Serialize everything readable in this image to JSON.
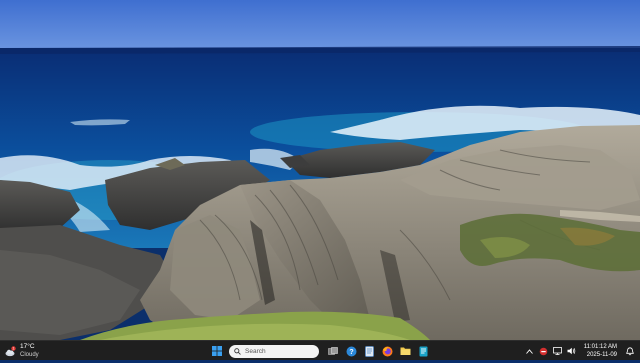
{
  "wallpaper": {
    "description_icon": "coastal-landscape",
    "colors": {
      "sky": "#3a6fd0",
      "ocean": "#0b3f86",
      "rock": "#8a8478"
    }
  },
  "taskbar": {
    "weather": {
      "temp": "17°C",
      "condition": "Cloudy",
      "badge": "1",
      "icon": "weather-cloud-icon"
    },
    "search": {
      "placeholder": "Search"
    },
    "apps": [
      {
        "name": "start",
        "icon": "windows-logo-icon"
      },
      {
        "name": "task-view",
        "icon": "task-view-icon"
      },
      {
        "name": "help",
        "icon": "help-icon"
      },
      {
        "name": "notepad",
        "icon": "notepad-icon"
      },
      {
        "name": "firefox",
        "icon": "firefox-icon"
      },
      {
        "name": "file-explorer",
        "icon": "folder-icon"
      },
      {
        "name": "app",
        "icon": "app-icon"
      }
    ],
    "tray": {
      "chevron": "chevron-up-icon",
      "clock": {
        "time": "11:01:12 AM",
        "date": "2025-11-09"
      }
    },
    "colors": {
      "background": "#1f1f1f",
      "search_bg": "#f3f3f3",
      "accent": "#0078d4"
    }
  }
}
